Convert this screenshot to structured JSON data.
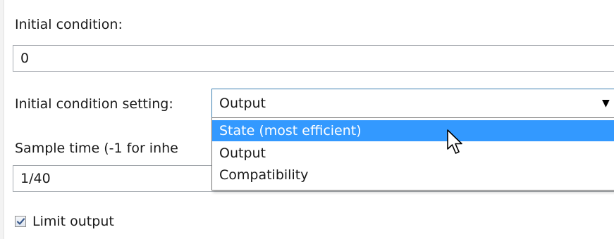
{
  "initial_condition": {
    "label": "Initial condition:",
    "value": "0"
  },
  "ic_setting": {
    "label": "Initial condition setting:",
    "selected": "Output",
    "options": [
      {
        "label": "State (most efficient)",
        "highlighted": true
      },
      {
        "label": "Output",
        "highlighted": false
      },
      {
        "label": "Compatibility",
        "highlighted": false
      }
    ]
  },
  "sample_time": {
    "label": "Sample time (-1 for inhe",
    "value": "1/40"
  },
  "limit_output": {
    "label": "Limit output",
    "checked": true
  },
  "colors": {
    "highlight": "#3399ff",
    "focus_border": "#3c7fb1"
  },
  "icons": {
    "caret": "chevron-down-icon",
    "check": "checkmark-icon",
    "cursor": "mouse-pointer-icon"
  }
}
